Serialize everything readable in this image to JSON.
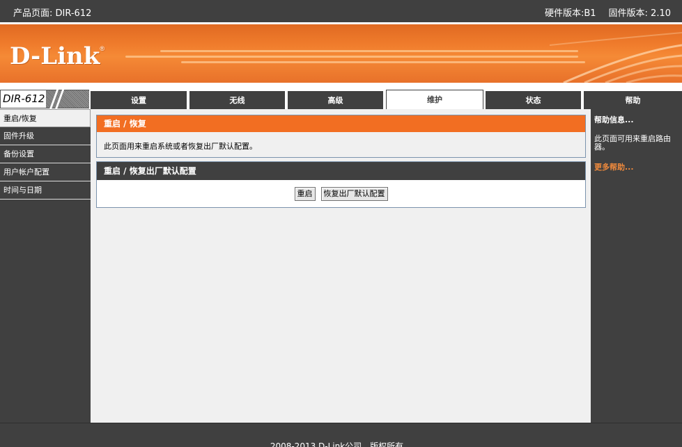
{
  "topbar": {
    "product": "产品页面: DIR-612",
    "hardware": "硬件版本:B1",
    "firmware": "固件版本: 2.10"
  },
  "brand": {
    "logo": "D-Link",
    "registered": "®"
  },
  "nav": {
    "model": "DIR-612",
    "tabs": [
      {
        "label": "设置"
      },
      {
        "label": "无线"
      },
      {
        "label": "高级"
      },
      {
        "label": "维护"
      },
      {
        "label": "状态"
      },
      {
        "label": "帮助"
      }
    ],
    "active_tab": "维护"
  },
  "sidebar": {
    "items": [
      {
        "label": "重启/恢复"
      },
      {
        "label": "固件升级"
      },
      {
        "label": "备份设置"
      },
      {
        "label": "用户帐户配置"
      },
      {
        "label": "时间与日期"
      }
    ],
    "active_item": "重启/恢复"
  },
  "main": {
    "section1": {
      "title": "重启 / 恢复",
      "description": "此页面用来重启系统或者恢复出厂默认配置。"
    },
    "section2": {
      "title": "重启 / 恢复出厂默认配置",
      "reboot_button": "重启",
      "restore_button": "恢复出厂默认配置"
    }
  },
  "help": {
    "title": "帮助信息...",
    "text": "此页面可用来重启路由器。",
    "more": "更多帮助..."
  },
  "footer": {
    "copyright": "2008-2013 D-Link公司，版权所有。"
  },
  "colors": {
    "accent": "#f26e22",
    "dark": "#404040",
    "content_bg": "#f0f0f0",
    "link": "#f08a3c"
  }
}
